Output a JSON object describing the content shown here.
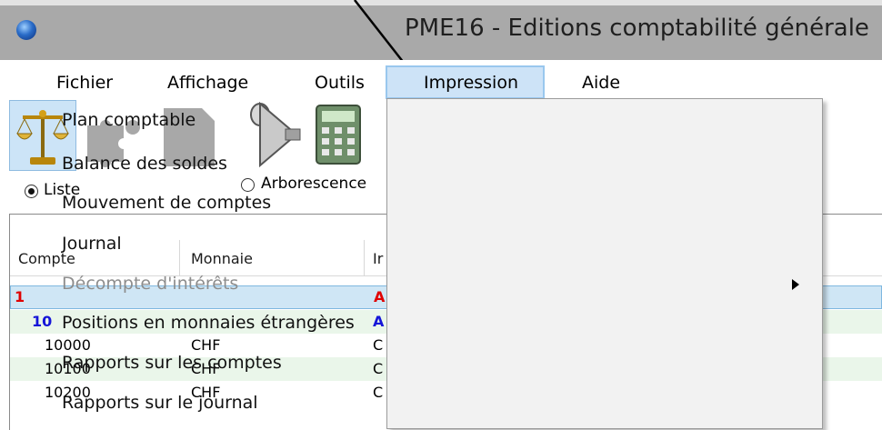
{
  "window": {
    "title": "PME16 - Editions comptabilité générale"
  },
  "menubar": {
    "items": [
      {
        "label": "Fichier"
      },
      {
        "label": "Affichage"
      },
      {
        "label": "Outils"
      },
      {
        "label": "Impression",
        "active": true
      },
      {
        "label": "Aide"
      }
    ]
  },
  "toolbar": {
    "icons": [
      "balance-scale-icon",
      "puzzle-icon",
      "document-icon",
      "funnel-icon",
      "calculator-icon"
    ]
  },
  "view_mode": {
    "list_label": "Liste",
    "list_selected": true,
    "tree_label": "Arborescence",
    "tree_selected": false
  },
  "table": {
    "columns": [
      "Compte",
      "Monnaie",
      "Ir"
    ],
    "rows": [
      {
        "compte": "1",
        "monnaie": "",
        "intitule": "A",
        "style": "class-red"
      },
      {
        "compte": "10",
        "monnaie": "",
        "intitule": "A",
        "style": "group-blue"
      },
      {
        "compte": "10000",
        "monnaie": "CHF",
        "intitule": "C",
        "style": "account"
      },
      {
        "compte": "10100",
        "monnaie": "CHF",
        "intitule": "C",
        "style": "account"
      },
      {
        "compte": "10200",
        "monnaie": "CHF",
        "intitule": "C",
        "style": "account"
      }
    ]
  },
  "dropdown": {
    "items": [
      {
        "label": "Plan comptable",
        "enabled": true
      },
      {
        "label": "Balance des soldes",
        "enabled": true
      },
      {
        "label": "Mouvement de comptes",
        "enabled": true
      },
      {
        "label": "Journal",
        "enabled": true
      },
      {
        "label": "Décompte d'intérêts",
        "enabled": false,
        "submenu": true
      },
      {
        "label": "Positions en monnaies étrangères",
        "enabled": true
      },
      {
        "label": "Rapports sur les comptes",
        "enabled": true
      },
      {
        "label": "Rapports sur le journal",
        "enabled": true
      }
    ]
  },
  "colors": {
    "titlebar": "#a9a9a9",
    "menu_highlight": "#cde3f7",
    "row_selected": "#cfe6f5",
    "row_alt": "#eaf6ea",
    "red_text": "#e00000",
    "blue_text": "#1515d8"
  }
}
